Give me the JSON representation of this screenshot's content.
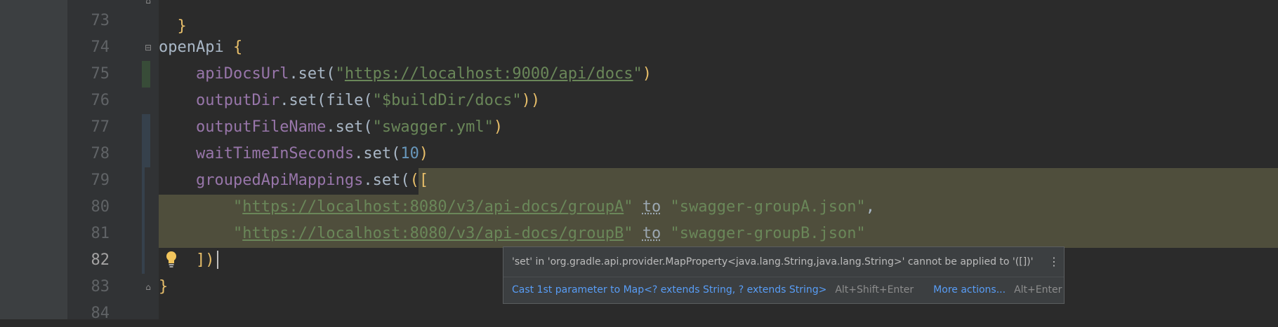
{
  "editor": {
    "lines": [
      {
        "number": "73",
        "current": false
      },
      {
        "number": "74",
        "current": false
      },
      {
        "number": "75",
        "current": false
      },
      {
        "number": "76",
        "current": false
      },
      {
        "number": "77",
        "current": false
      },
      {
        "number": "78",
        "current": false
      },
      {
        "number": "79",
        "current": false
      },
      {
        "number": "80",
        "current": false
      },
      {
        "number": "81",
        "current": false
      },
      {
        "number": "82",
        "current": true
      },
      {
        "number": "83",
        "current": false
      },
      {
        "number": "84",
        "current": false
      }
    ],
    "code": {
      "top_brace": "}",
      "open_api_ident": "openApi",
      "open_api_brace": "{",
      "api_docs_url_prop": "apiDocsUrl",
      "set_call": ".set(",
      "quote": "\"",
      "api_docs_url_value": "https://localhost:9000/api/docs",
      "close_paren": ")",
      "output_dir_prop": "outputDir",
      "file_call": "file(",
      "output_dir_value": "\"$buildDir/docs\"",
      "close_parens_double": "))",
      "output_file_name_prop": "outputFileName",
      "output_file_name_value": "\"swagger.yml\"",
      "wait_time_prop": "waitTimeInSeconds",
      "wait_time_value": "10",
      "grouped_prop": "groupedApiMappings",
      "grouped_open": "([",
      "group_a_url": "https://localhost:8080/v3/api-docs/groupA",
      "group_b_url": "https://localhost:8080/v3/api-docs/groupB",
      "to_keyword": "to",
      "group_a_file": "\"swagger-groupA.json\"",
      "group_b_file": "\"swagger-groupB.json\"",
      "comma": ",",
      "grouped_close": "])",
      "block_close": "}"
    }
  },
  "intention_popup": {
    "message": "'set' in 'org.gradle.api.provider.MapProperty<java.lang.String,java.lang.String>' cannot be applied to '([])'",
    "fix_action": "Cast 1st parameter to Map<? extends String, ? extends String>",
    "fix_shortcut": "Alt+Shift+Enter",
    "more_action": "More actions...",
    "more_shortcut": "Alt+Enter",
    "more_icon": "kebab-vertical-icon"
  },
  "colors": {
    "background": "#2b2b2b",
    "keyword_property": "#9876aa",
    "string": "#6a8759",
    "number": "#6897bb",
    "selection": "#4f4e3c",
    "link": "#589df6"
  }
}
